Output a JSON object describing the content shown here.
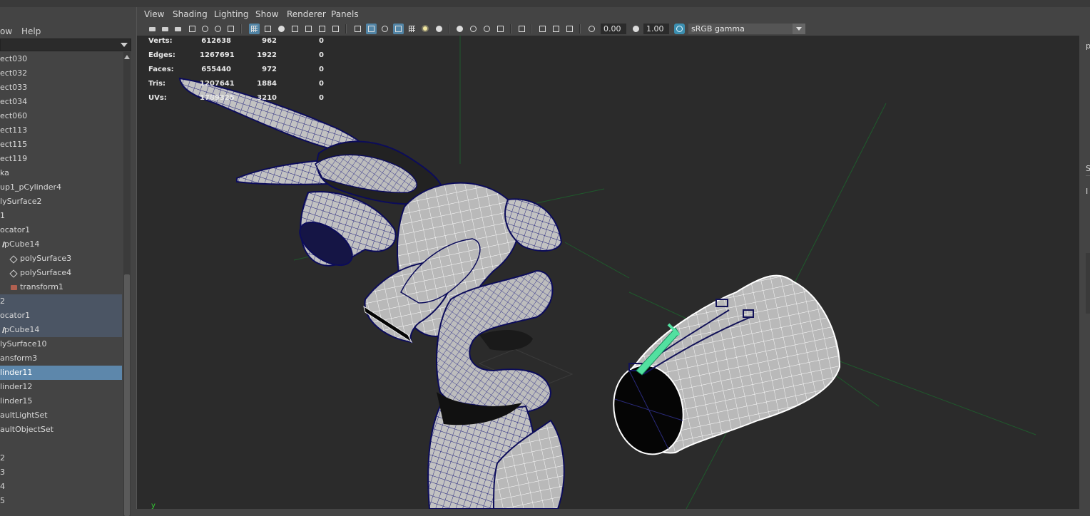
{
  "outliner": {
    "menu": {
      "show": "ow",
      "help": "Help"
    },
    "items": [
      {
        "label": "ect030",
        "indent": 0,
        "icon": "",
        "state": ""
      },
      {
        "label": "ect032",
        "indent": 0,
        "icon": "",
        "state": ""
      },
      {
        "label": "ect033",
        "indent": 0,
        "icon": "",
        "state": ""
      },
      {
        "label": "ect034",
        "indent": 0,
        "icon": "",
        "state": ""
      },
      {
        "label": "ect060",
        "indent": 0,
        "icon": "",
        "state": ""
      },
      {
        "label": "ect113",
        "indent": 0,
        "icon": "",
        "state": ""
      },
      {
        "label": "ect115",
        "indent": 0,
        "icon": "",
        "state": ""
      },
      {
        "label": "ect119",
        "indent": 0,
        "icon": "",
        "state": ""
      },
      {
        "label": "ka",
        "indent": 0,
        "icon": "",
        "state": ""
      },
      {
        "label": "up1_pCylinder4",
        "indent": 0,
        "icon": "",
        "state": ""
      },
      {
        "label": "lySurface2",
        "indent": 0,
        "icon": "",
        "state": ""
      },
      {
        "label": "1",
        "indent": 0,
        "icon": "",
        "state": ""
      },
      {
        "label": "ocator1",
        "indent": 0,
        "icon": "",
        "state": ""
      },
      {
        "label": "pCube14",
        "indent": 6,
        "icon": "tick",
        "state": ""
      },
      {
        "label": "polySurface3",
        "indent": 17,
        "icon": "diamond",
        "state": ""
      },
      {
        "label": "polySurface4",
        "indent": 17,
        "icon": "diamond",
        "state": ""
      },
      {
        "label": "transform1",
        "indent": 17,
        "icon": "xform",
        "state": ""
      },
      {
        "label": "2",
        "indent": 0,
        "icon": "",
        "state": "sel-light"
      },
      {
        "label": "ocator1",
        "indent": 0,
        "icon": "",
        "state": "sel-light"
      },
      {
        "label": "pCube14",
        "indent": 6,
        "icon": "tick",
        "state": "sel-light"
      },
      {
        "label": "lySurface10",
        "indent": 0,
        "icon": "",
        "state": ""
      },
      {
        "label": "ansform3",
        "indent": 0,
        "icon": "",
        "state": ""
      },
      {
        "label": "linder11",
        "indent": 0,
        "icon": "",
        "state": "sel"
      },
      {
        "label": "linder12",
        "indent": 0,
        "icon": "",
        "state": ""
      },
      {
        "label": "linder15",
        "indent": 0,
        "icon": "",
        "state": ""
      },
      {
        "label": "aultLightSet",
        "indent": 0,
        "icon": "",
        "state": ""
      },
      {
        "label": "aultObjectSet",
        "indent": 0,
        "icon": "",
        "state": ""
      },
      {
        "label": "",
        "indent": 0,
        "icon": "",
        "state": ""
      },
      {
        "label": "2",
        "indent": 0,
        "icon": "",
        "state": ""
      },
      {
        "label": "3",
        "indent": 0,
        "icon": "",
        "state": ""
      },
      {
        "label": "4",
        "indent": 0,
        "icon": "",
        "state": ""
      },
      {
        "label": "5",
        "indent": 0,
        "icon": "",
        "state": ""
      }
    ]
  },
  "panel": {
    "menu": {
      "view": "View",
      "shading": "Shading",
      "lighting": "Lighting",
      "show": "Show",
      "renderer": "Renderer",
      "panels": "Panels"
    },
    "toolbar": {
      "exposure": "0.00",
      "gamma": "1.00",
      "color_space": "sRGB gamma"
    }
  },
  "hud": {
    "rows": [
      {
        "key": "Verts:",
        "v1": "612638",
        "v2": "962",
        "v3": "0"
      },
      {
        "key": "Edges:",
        "v1": "1267691",
        "v2": "1922",
        "v3": "0"
      },
      {
        "key": "Faces:",
        "v1": "655440",
        "v2": "972",
        "v3": "0"
      },
      {
        "key": "Tris:",
        "v1": "1207641",
        "v2": "1884",
        "v3": "0"
      },
      {
        "key": "UVs:",
        "v1": "1789325",
        "v2": "3210",
        "v3": "0"
      }
    ]
  },
  "right_panel": {
    "label_top": "p",
    "label_mid": "S",
    "label_low": "I"
  },
  "colors": {
    "selection": "#5d87ab",
    "wire_selected": "#1a1a6e",
    "mesh": "#b8b8b8",
    "highlight": "#52e0a0"
  }
}
